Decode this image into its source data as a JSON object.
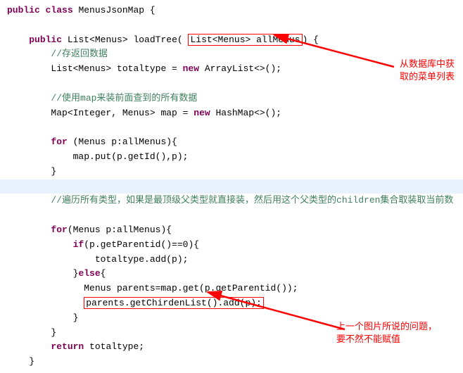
{
  "code": {
    "l1_kw1": "public",
    "l1_kw2": "class",
    "l1_name": "MenusJsonMap {",
    "l2_kw1": "public",
    "l2_type": "List<Menus> loadTree( ",
    "l2_param": "List<Menus> allMenus",
    "l2_end": ") {",
    "l3_comment": "//存返回数据",
    "l4_a": "List<Menus> totaltype = ",
    "l4_kw": "new",
    "l4_b": " ArrayList<>();",
    "l5_comment": "//使用map来装前面查到的所有数据",
    "l6_a": "Map<Integer, Menus> map = ",
    "l6_kw": "new",
    "l6_b": " HashMap<>();",
    "l7_kw": "for",
    "l7_a": " (Menus p:allMenus){",
    "l8": "map.put(p.getId(),p);",
    "l9": "}",
    "l10_comment": "//遍历所有类型，如果是最顶级父类型就直接装，然后用这个父类型的children集合取装取当前数",
    "l11_kw": "for",
    "l11_a": "(Menus p:allMenus){",
    "l12_kw": "if",
    "l12_a": "(p.getParentid()==0){",
    "l13": "totaltype.add(p);",
    "l14_a": "}",
    "l14_kw": "else",
    "l14_b": "{",
    "l15": "Menus parents=map.get(p.getParentid());",
    "l16": "parents.getChirdenList().add(p);",
    "l17": "}",
    "l18": "}",
    "l19_kw": "return",
    "l19_a": " totaltype;",
    "l20": "}"
  },
  "annotations": {
    "note1": "从数据库中获取的菜单列表",
    "note2": "上一个图片所说的问题，要不然不能赋值"
  }
}
